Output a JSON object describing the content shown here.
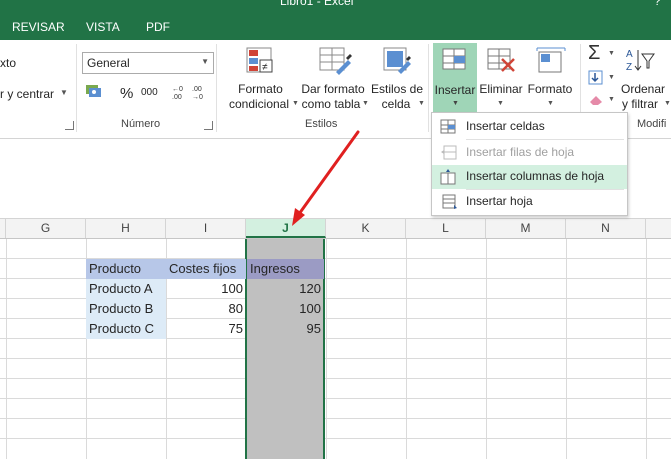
{
  "window": {
    "title": "Libro1 - Excel",
    "help": "?"
  },
  "tabs": [
    "REVISAR",
    "VISTA",
    "PDF"
  ],
  "ribbon": {
    "alineacion": {
      "texto_fragment": "xto",
      "centrar": "r y centrar"
    },
    "numero": {
      "format_value": "General",
      "percent": "%",
      "thousands": "000",
      "group_label": "Número"
    },
    "estilos": {
      "formato_condicional": [
        "Formato",
        "condicional"
      ],
      "dar_formato_tabla": [
        "Dar formato",
        "como tabla"
      ],
      "estilos_celda": [
        "Estilos de",
        "celda"
      ],
      "group_label": "Estilos"
    },
    "celdas": {
      "insertar": "Insertar",
      "eliminar": "Eliminar",
      "formato": "Formato"
    },
    "modificar": {
      "ordenar": [
        "Ordenar",
        "y filtrar"
      ],
      "group_label_fragment": "Modifi"
    }
  },
  "insert_menu": {
    "items": [
      {
        "label": "Insertar celdas",
        "enabled": true
      },
      {
        "label": "Insertar filas de hoja",
        "enabled": false
      },
      {
        "label": "Insertar columnas de hoja",
        "enabled": true,
        "highlighted": true
      },
      {
        "label": "Insertar hoja",
        "enabled": true
      }
    ]
  },
  "columns": [
    "G",
    "H",
    "I",
    "J",
    "K",
    "L",
    "M",
    "N"
  ],
  "selected_column": "J",
  "table": {
    "headers": [
      "Producto",
      "Costes fijos",
      "Ingresos"
    ],
    "rows": [
      [
        "Producto A",
        "100",
        "120"
      ],
      [
        "Producto B",
        "80",
        "100"
      ],
      [
        "Producto C",
        "75",
        "95"
      ]
    ]
  },
  "colors": {
    "excel_green": "#217346",
    "selection": "#c0c0c0",
    "table_header_blue": "#b7c7e8",
    "ingresos_header": "#9b9bc4",
    "product_fill": "#ddebf7",
    "arrow": "#e02020"
  }
}
